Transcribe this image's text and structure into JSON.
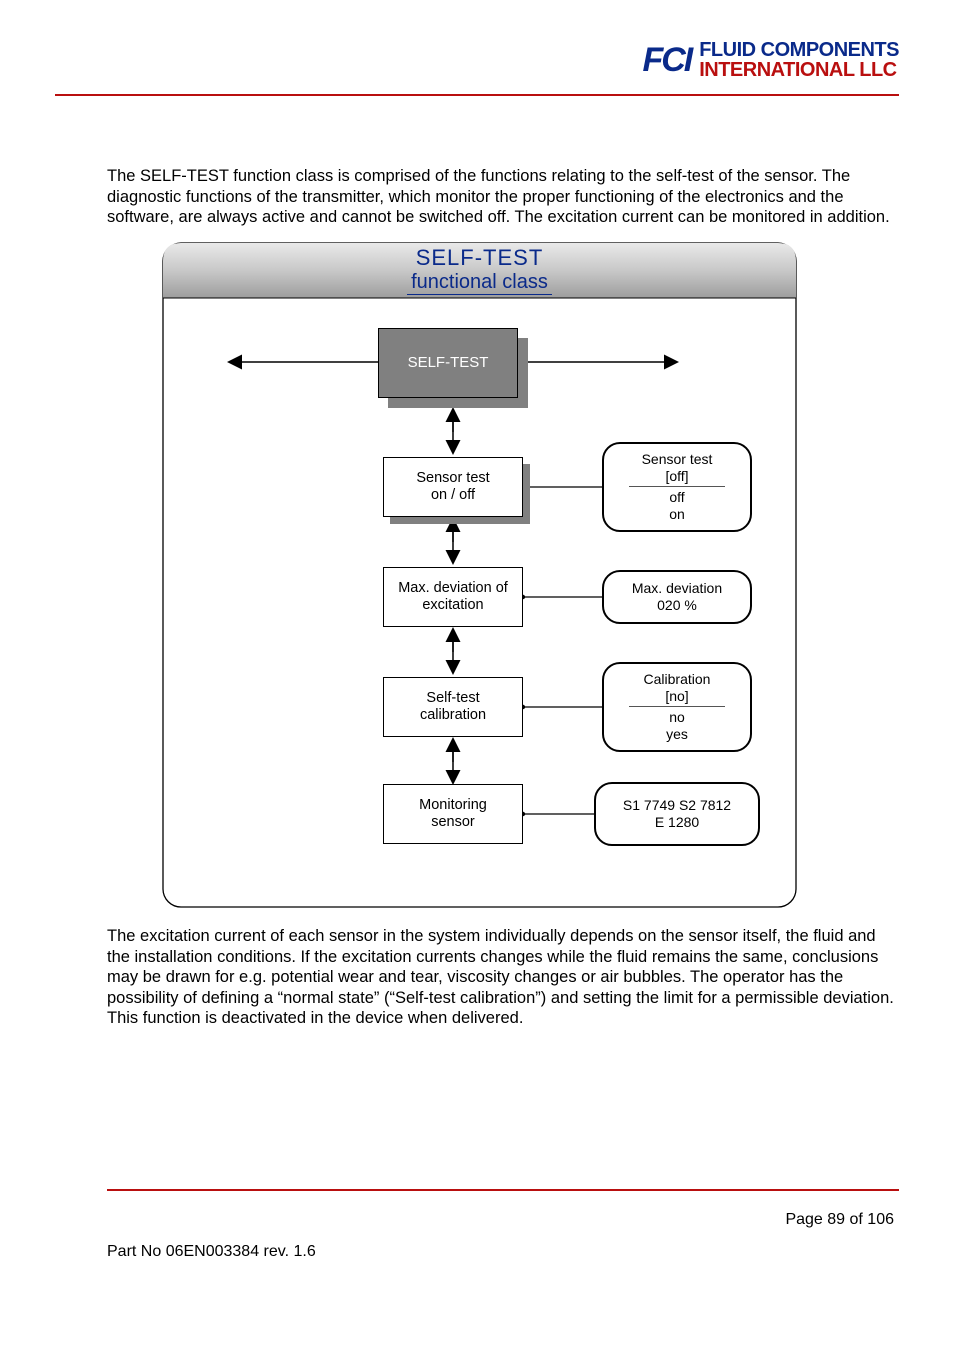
{
  "logo": {
    "mark": "FCI",
    "line1": "FLUID COMPONENTS",
    "line2": "INTERNATIONAL LLC"
  },
  "intro": "The SELF-TEST function class is comprised of the functions relating to the self-test of the sensor. The diagnostic functions of the transmitter, which monitor the proper functioning of the electronics and the software, are always active and cannot be switched off. The excitation current can be monitored in addition.",
  "diagram": {
    "title": "SELF-TEST",
    "subtitle": "functional class",
    "main_node": "SELF-TEST",
    "nodes": [
      {
        "line1": "Sensor test",
        "line2": "on / off"
      },
      {
        "line1": "Max. deviation of",
        "line2": "excitation"
      },
      {
        "line1": "Self-test",
        "line2": "calibration"
      },
      {
        "line1": "Monitoring",
        "line2": "sensor"
      }
    ],
    "values": [
      {
        "title": "Sensor test",
        "current": "[off]",
        "opts": [
          "off",
          "on"
        ]
      },
      {
        "title": "Max. deviation",
        "current": "020 %",
        "opts": []
      },
      {
        "title": "Calibration",
        "current": "[no]",
        "opts": [
          "no",
          "yes"
        ]
      },
      {
        "title": "S1 7749   S2 7812",
        "current": "E 1280",
        "opts": []
      }
    ]
  },
  "outro": "The excitation current of each sensor in the system individually depends on the sensor itself, the fluid and the installation conditions. If the excitation currents changes while the fluid remains the same, conclusions may be drawn for e.g. potential wear and tear, viscosity changes or air bubbles. The operator has the possibility of defining a “normal state” (“Self-test calibration”) and setting the limit for a permissible deviation. This function is deactivated in the device when delivered.",
  "footer": {
    "page": "Page 89 of 106",
    "part": "Part No 06EN003384 rev. 1.6"
  }
}
